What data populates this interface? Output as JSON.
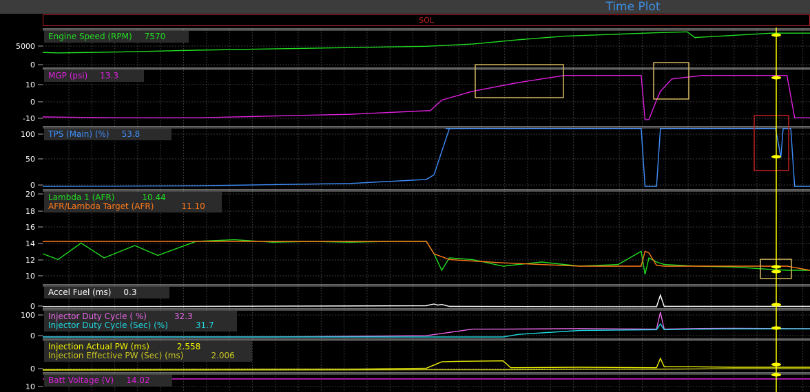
{
  "window": {
    "title": "Time Plot",
    "marker_label": "SOL"
  },
  "colors": {
    "grid": "#3a3a3a",
    "cursor": "#ffff00",
    "box_yellow": "#d8b860",
    "box_red": "#c02020"
  },
  "chart_data": [
    {
      "type": "line",
      "name": "engine-speed",
      "yticks": [
        "5000",
        "0"
      ],
      "ylim": [
        0,
        8000
      ],
      "series": [
        {
          "name": "Engine Speed (RPM)",
          "value": "7570",
          "color": "#22dd22",
          "x": [
            0,
            0.02,
            0.1,
            0.2,
            0.3,
            0.4,
            0.5,
            0.56,
            0.62,
            0.68,
            0.74,
            0.8,
            0.84,
            0.85,
            0.86,
            0.9,
            0.95,
            1
          ],
          "values": [
            3100,
            3000,
            3200,
            3600,
            3900,
            4200,
            4500,
            5000,
            6000,
            6800,
            7200,
            7600,
            7800,
            6500,
            6600,
            7000,
            7500,
            7500
          ]
        }
      ]
    },
    {
      "type": "line",
      "name": "mgp",
      "yticks": [
        "10",
        "0",
        "-10"
      ],
      "ylim": [
        -13,
        17
      ],
      "series": [
        {
          "name": "MGP (psi)",
          "value": "13.3",
          "color": "#e020e0",
          "x": [
            0,
            0.1,
            0.2,
            0.3,
            0.4,
            0.5,
            0.505,
            0.52,
            0.56,
            0.62,
            0.68,
            0.7,
            0.78,
            0.785,
            0.79,
            0.8,
            0.805,
            0.82,
            0.86,
            0.9,
            0.97,
            0.98,
            1
          ],
          "values": [
            -9.5,
            -10,
            -10,
            -9,
            -8,
            -6,
            -6,
            0,
            5,
            10,
            14,
            14,
            14,
            -11,
            -11,
            0,
            5,
            12,
            14,
            14,
            14,
            -10,
            -10
          ]
        }
      ]
    },
    {
      "type": "line",
      "name": "tps",
      "yticks": [
        "100",
        "50",
        "0"
      ],
      "ylim": [
        0,
        100
      ],
      "series": [
        {
          "name": "TPS (Main) (%)",
          "value": "53.8",
          "color": "#4090ff",
          "x": [
            0,
            0.2,
            0.4,
            0.5,
            0.51,
            0.53,
            0.525,
            0.78,
            0.785,
            0.79,
            0.8,
            0.805,
            0.955,
            0.958,
            0.962,
            0.965,
            0.975,
            0.98,
            1
          ],
          "values": [
            0,
            1,
            5,
            12,
            20,
            100,
            100,
            100,
            0,
            0,
            0,
            100,
            100,
            80,
            50,
            100,
            100,
            0,
            0
          ]
        }
      ]
    },
    {
      "type": "line",
      "name": "afr",
      "yticks": [
        "20",
        "18",
        "16",
        "14",
        "12",
        "10"
      ],
      "ylim": [
        9,
        20
      ],
      "series": [
        {
          "name": "Lambda 1 (AFR)",
          "value": "10.44",
          "color": "#22dd22",
          "x": [
            0,
            0.02,
            0.05,
            0.08,
            0.12,
            0.15,
            0.2,
            0.25,
            0.3,
            0.35,
            0.4,
            0.45,
            0.5,
            0.51,
            0.52,
            0.53,
            0.56,
            0.6,
            0.65,
            0.7,
            0.75,
            0.78,
            0.785,
            0.79,
            0.8,
            0.81,
            0.85,
            0.9,
            0.95,
            0.97,
            1
          ],
          "values": [
            12.5,
            11.8,
            13.8,
            12.0,
            13.5,
            12.3,
            14.0,
            14.2,
            13.9,
            14.0,
            13.9,
            14.0,
            14.0,
            12.5,
            10.5,
            12.0,
            11.8,
            11.0,
            11.5,
            11.0,
            11.2,
            12.8,
            10.0,
            12.0,
            11.5,
            11.2,
            11.0,
            10.9,
            10.6,
            10.5,
            10.5
          ]
        },
        {
          "name": "AFR/Lambda Target (AFR)",
          "value": "11.10",
          "color": "#ff7a1a",
          "x": [
            0,
            0.5,
            0.51,
            0.53,
            0.6,
            0.7,
            0.78,
            0.785,
            0.79,
            0.8,
            0.81,
            0.9,
            0.97,
            1
          ],
          "values": [
            14.0,
            14.0,
            12.5,
            11.8,
            11.4,
            11.0,
            11.0,
            12.8,
            12.6,
            11.1,
            11.0,
            11.0,
            11.0,
            10.5
          ]
        }
      ]
    },
    {
      "type": "line",
      "name": "accel-fuel",
      "yticks": [
        "0"
      ],
      "ylim": [
        0,
        6
      ],
      "series": [
        {
          "name": "Accel Fuel (ms)",
          "value": "0.3",
          "color": "#ffffff",
          "x": [
            0,
            0.5,
            0.505,
            0.51,
            0.515,
            0.52,
            0.53,
            0.8,
            0.805,
            0.81,
            1
          ],
          "values": [
            0,
            0.3,
            0.6,
            0.8,
            0.5,
            0.7,
            0.1,
            0,
            3.5,
            0.1,
            0.1
          ]
        }
      ]
    },
    {
      "type": "line",
      "name": "injector-duty",
      "yticks": [
        "100",
        "0"
      ],
      "ylim": [
        0,
        100
      ],
      "series": [
        {
          "name": "Injector Duty Cycle ( %)",
          "value": "32.3",
          "color": "#e868e8",
          "x": [
            0,
            0.3,
            0.5,
            0.56,
            0.6,
            0.7,
            0.8,
            0.805,
            0.81,
            0.85,
            0.9,
            0.97,
            1
          ],
          "values": [
            0,
            0,
            5,
            30,
            30,
            32,
            30,
            95,
            30,
            32,
            33,
            32,
            32
          ]
        },
        {
          "name": "Injector Duty Cycle (Sec) (%)",
          "value": "31.7",
          "color": "#20d8e0",
          "x": [
            0,
            0.5,
            0.6,
            0.62,
            0.7,
            0.8,
            0.805,
            0.81,
            0.85,
            0.9,
            0.97,
            1
          ],
          "values": [
            0,
            0,
            0,
            10,
            25,
            28,
            50,
            28,
            30,
            31,
            31,
            31
          ]
        }
      ]
    },
    {
      "type": "line",
      "name": "injection-pw",
      "yticks": [
        "0"
      ],
      "ylim": [
        0,
        6
      ],
      "series": [
        {
          "name": "Injection Actual PW (ms)",
          "value": "2.558",
          "color": "#f0f000",
          "x": [
            0,
            0.4,
            0.5,
            0.52,
            0.54,
            0.6,
            0.61,
            0.7,
            0.8,
            0.805,
            0.81,
            0.85,
            0.9,
            1
          ],
          "values": [
            0.2,
            0.3,
            0.5,
            1.8,
            1.9,
            2.0,
            0.6,
            0.7,
            0.6,
            2.5,
            0.8,
            0.8,
            0.7,
            0.7
          ]
        },
        {
          "name": "Injection Effective PW (Sec) (ms)",
          "value": "2.006",
          "color": "#c8c820",
          "x": [
            0,
            0.5,
            0.6,
            0.7,
            0.8,
            0.9,
            1
          ],
          "values": [
            0.1,
            0.2,
            0.2,
            0.3,
            0.3,
            0.4,
            0.4
          ]
        }
      ]
    },
    {
      "type": "line",
      "name": "batt-voltage",
      "yticks": [
        "10"
      ],
      "ylim": [
        8,
        16
      ],
      "series": [
        {
          "name": "Batt Voltage (V)",
          "value": "14.02",
          "color": "#e020e0",
          "x": [
            0,
            1
          ],
          "values": [
            14.0,
            14.0
          ]
        }
      ]
    }
  ]
}
